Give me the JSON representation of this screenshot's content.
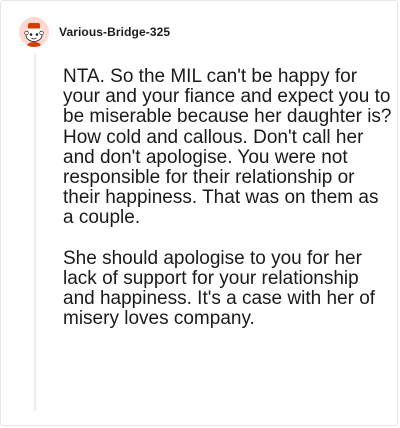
{
  "comment": {
    "username": "Various-Bridge-325",
    "avatar_icon": "snoo-avatar-icon",
    "paragraphs": [
      "NTA. So the MIL can't be happy for your and your fiance and expect you to be miserable because her daughter is? How cold and callous. Don't call her and don't apologise. You were not responsible for their relationship or their happiness. That was on them as a couple.",
      "She should apologise to you for her lack of support for your relationship and happiness. It's a case with her of misery loves company."
    ]
  },
  "colors": {
    "avatar_bg": "#ffd8d2",
    "avatar_accent": "#d93a00",
    "thread_line": "#ededed",
    "text": "#1a1a1b"
  }
}
